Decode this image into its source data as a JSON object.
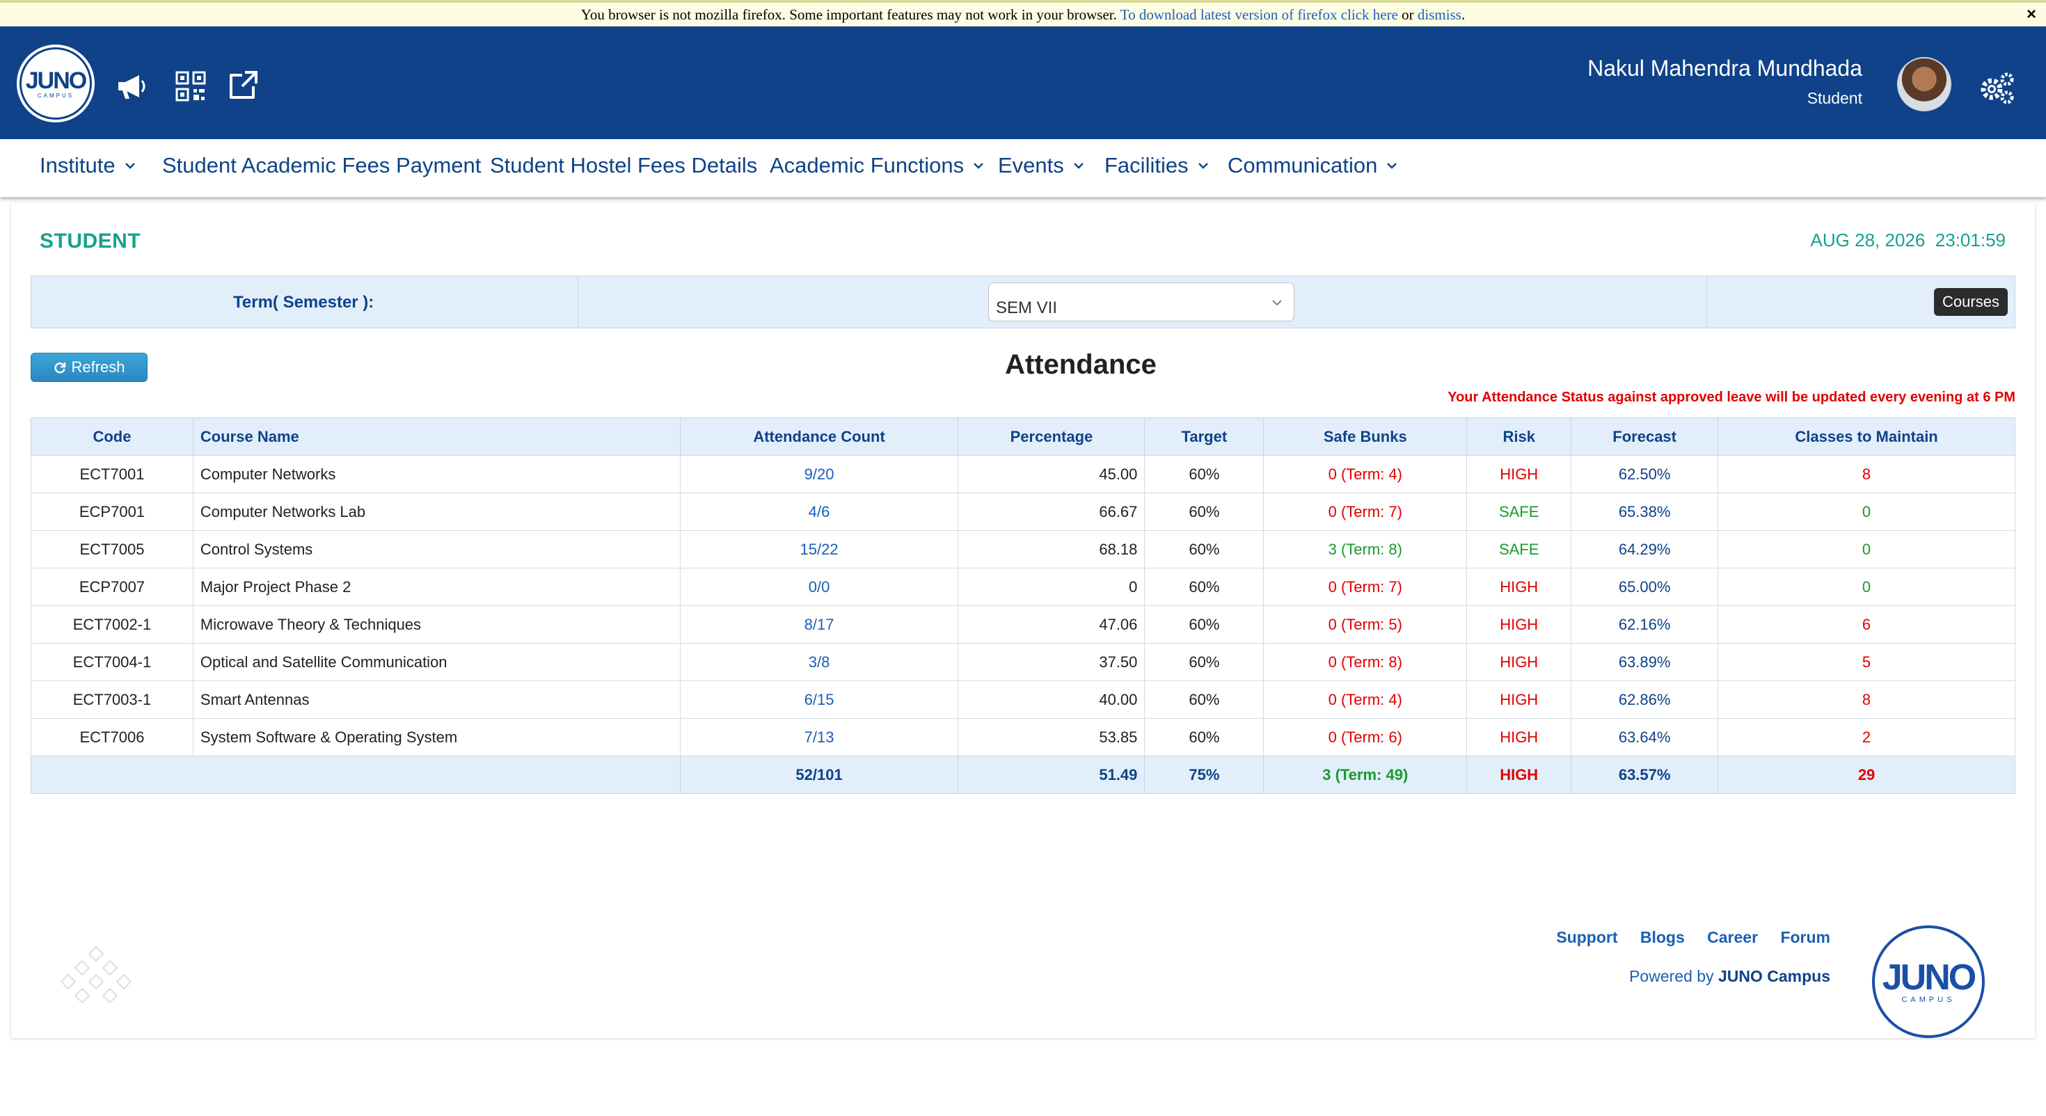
{
  "browser_warning": {
    "text": "You browser is not mozilla firefox. Some important features may not work in your browser.",
    "download_link": "To download latest version of firefox click here",
    "or_text": "or",
    "dismiss_link": "dismiss",
    "close_label": "×"
  },
  "header": {
    "logo_text": "JUNO",
    "logo_sub": "CAMPUS",
    "user_name": "Nakul Mahendra Mundhada",
    "user_role": "Student",
    "icons": [
      "megaphone-icon",
      "qr-code-icon",
      "external-link-icon",
      "gears-icon"
    ]
  },
  "nav": {
    "items": [
      {
        "label": "Institute",
        "dropdown": true
      },
      {
        "label": "Student Academic Fees Payment",
        "dropdown": false
      },
      {
        "label": "Student Hostel Fees Details",
        "dropdown": false
      },
      {
        "label": "Academic Functions",
        "dropdown": true
      },
      {
        "label": "Events",
        "dropdown": true
      },
      {
        "label": "Facilities",
        "dropdown": true
      },
      {
        "label": "Communication",
        "dropdown": true
      }
    ]
  },
  "page": {
    "title": "STUDENT",
    "date": "AUG 28, 2026",
    "time": "23:01:59",
    "term_label": "Term( Semester ):",
    "term_value": "SEM VII",
    "courses_button": "Courses",
    "refresh_button": "Refresh",
    "heading": "Attendance",
    "note": "Your Attendance Status against approved leave will be updated every evening at 6 PM"
  },
  "table": {
    "headers": [
      "Code",
      "Course Name",
      "Attendance Count",
      "Percentage",
      "Target",
      "Safe Bunks",
      "Risk",
      "Forecast",
      "Classes to Maintain"
    ],
    "rows": [
      {
        "code": "ECT7001",
        "name": "Computer Networks",
        "count": "9/20",
        "pct": "45.00",
        "target": "60%",
        "bunks": "0 (Term: 4)",
        "risk": "HIGH",
        "forecast": "62.50%",
        "maintain": "8"
      },
      {
        "code": "ECP7001",
        "name": "Computer Networks Lab",
        "count": "4/6",
        "pct": "66.67",
        "target": "60%",
        "bunks": "0 (Term: 7)",
        "risk": "SAFE",
        "forecast": "65.38%",
        "maintain": "0"
      },
      {
        "code": "ECT7005",
        "name": "Control Systems",
        "count": "15/22",
        "pct": "68.18",
        "target": "60%",
        "bunks": "3 (Term: 8)",
        "risk": "SAFE",
        "forecast": "64.29%",
        "maintain": "0"
      },
      {
        "code": "ECP7007",
        "name": "Major Project Phase 2",
        "count": "0/0",
        "pct": "0",
        "target": "60%",
        "bunks": "0 (Term: 7)",
        "risk": "HIGH",
        "forecast": "65.00%",
        "maintain": "0"
      },
      {
        "code": "ECT7002-1",
        "name": "Microwave Theory & Techniques",
        "count": "8/17",
        "pct": "47.06",
        "target": "60%",
        "bunks": "0 (Term: 5)",
        "risk": "HIGH",
        "forecast": "62.16%",
        "maintain": "6"
      },
      {
        "code": "ECT7004-1",
        "name": "Optical and Satellite Communication",
        "count": "3/8",
        "pct": "37.50",
        "target": "60%",
        "bunks": "0 (Term: 8)",
        "risk": "HIGH",
        "forecast": "63.89%",
        "maintain": "5"
      },
      {
        "code": "ECT7003-1",
        "name": "Smart Antennas",
        "count": "6/15",
        "pct": "40.00",
        "target": "60%",
        "bunks": "0 (Term: 4)",
        "risk": "HIGH",
        "forecast": "62.86%",
        "maintain": "8"
      },
      {
        "code": "ECT7006",
        "name": "System Software & Operating System",
        "count": "7/13",
        "pct": "53.85",
        "target": "60%",
        "bunks": "0 (Term: 6)",
        "risk": "HIGH",
        "forecast": "63.64%",
        "maintain": "2"
      }
    ],
    "totals": {
      "count": "52/101",
      "pct": "51.49",
      "target": "75%",
      "bunks": "3 (Term: 49)",
      "risk": "HIGH",
      "forecast": "63.57%",
      "maintain": "29"
    }
  },
  "footer": {
    "links": [
      "Support",
      "Blogs",
      "Career",
      "Forum"
    ],
    "powered_prefix": "Powered by",
    "powered_brand": "JUNO Campus",
    "logo_text": "JUNO",
    "logo_sub": "CAMPUS"
  },
  "colors": {
    "header_bg": "#0f4289",
    "accent_green": "#13a38b",
    "risk_high": "#e00000",
    "risk_safe": "#1a9a2c",
    "link_blue": "#1a5fb4"
  }
}
